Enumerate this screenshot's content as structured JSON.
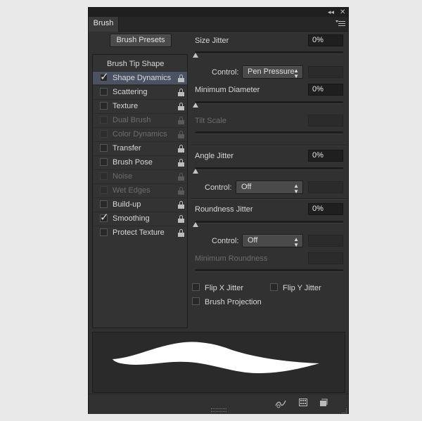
{
  "panel": {
    "title_tab": "Brush",
    "brush_presets_label": "Brush Presets"
  },
  "options": {
    "header": "Brush Tip Shape",
    "items": [
      {
        "label": "Shape Dynamics",
        "checked": true,
        "disabled": false,
        "selected": true
      },
      {
        "label": "Scattering",
        "checked": false,
        "disabled": false,
        "selected": false
      },
      {
        "label": "Texture",
        "checked": false,
        "disabled": false,
        "selected": false
      },
      {
        "label": "Dual Brush",
        "checked": false,
        "disabled": true,
        "selected": false
      },
      {
        "label": "Color Dynamics",
        "checked": false,
        "disabled": true,
        "selected": false
      },
      {
        "label": "Transfer",
        "checked": false,
        "disabled": false,
        "selected": false
      },
      {
        "label": "Brush Pose",
        "checked": false,
        "disabled": false,
        "selected": false
      },
      {
        "label": "Noise",
        "checked": false,
        "disabled": true,
        "selected": false
      },
      {
        "label": "Wet Edges",
        "checked": false,
        "disabled": true,
        "selected": false
      },
      {
        "label": "Build-up",
        "checked": false,
        "disabled": false,
        "selected": false
      },
      {
        "label": "Smoothing",
        "checked": true,
        "disabled": false,
        "selected": false
      },
      {
        "label": "Protect Texture",
        "checked": false,
        "disabled": false,
        "selected": false
      }
    ]
  },
  "settings": {
    "size_jitter": {
      "label": "Size Jitter",
      "value": "0%"
    },
    "size_control": {
      "label": "Control:",
      "value": "Pen Pressure"
    },
    "minimum_diameter": {
      "label": "Minimum Diameter",
      "value": "0%"
    },
    "tilt_scale": {
      "label": "Tilt Scale"
    },
    "angle_jitter": {
      "label": "Angle Jitter",
      "value": "0%"
    },
    "angle_control": {
      "label": "Control:",
      "value": "Off"
    },
    "roundness_jitter": {
      "label": "Roundness Jitter",
      "value": "0%"
    },
    "roundness_control": {
      "label": "Control:",
      "value": "Off"
    },
    "minimum_roundness": {
      "label": "Minimum Roundness"
    },
    "flip_x": {
      "label": "Flip X Jitter"
    },
    "flip_y": {
      "label": "Flip Y Jitter"
    },
    "brush_projection": {
      "label": "Brush Projection"
    }
  },
  "icons": {
    "collapse": "double-chevron-left-icon",
    "close": "close-icon",
    "menu": "panel-menu-icon",
    "toggle_live_tip": "brush-tip-preview-icon",
    "open_preset_manager": "grid-icon",
    "create_new_brush": "new-preset-icon"
  }
}
